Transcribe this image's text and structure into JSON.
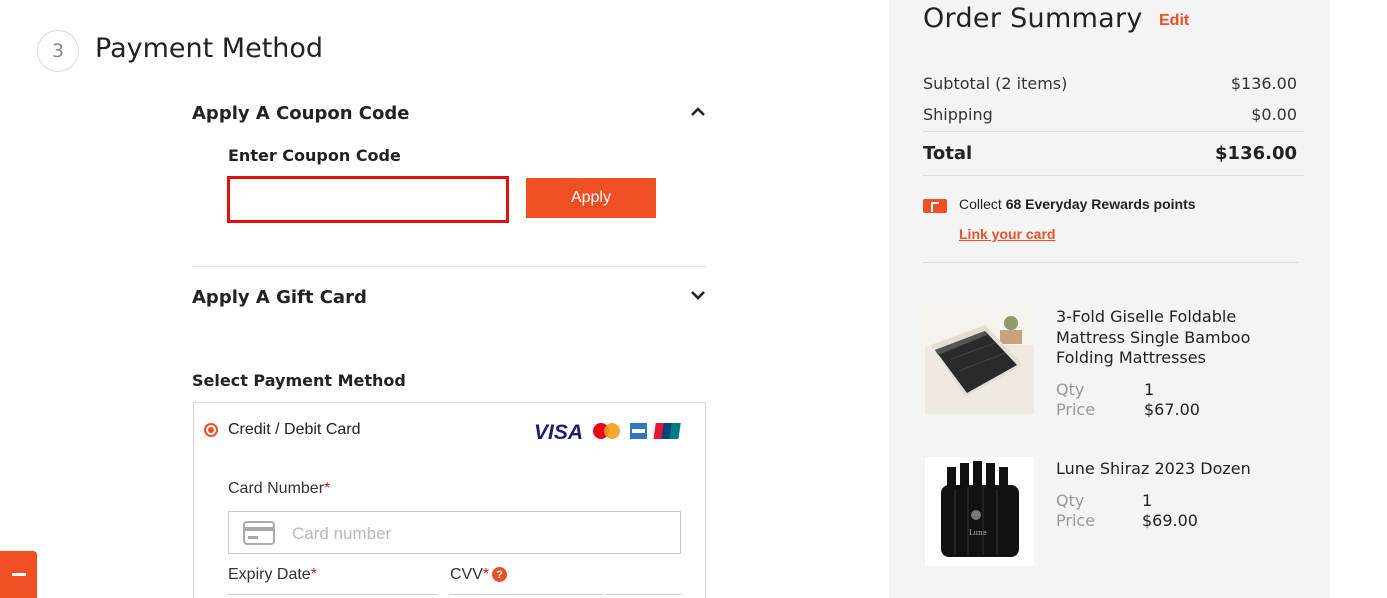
{
  "step": {
    "number": "3",
    "title": "Payment Method"
  },
  "coupon": {
    "heading": "Apply A Coupon Code",
    "field_label": "Enter Coupon Code",
    "value": "",
    "apply_label": "Apply"
  },
  "gift_card": {
    "heading": "Apply A Gift Card"
  },
  "payment": {
    "heading": "Select Payment Method",
    "option_label": "Credit / Debit Card",
    "card_logos": [
      "VISA",
      "mastercard",
      "amex",
      "unionpay"
    ],
    "card_number_label": "Card Number",
    "card_number_placeholder": "Card number",
    "expiry_label": "Expiry Date",
    "cvv_label": "CVV",
    "required_mark": "*",
    "help_glyph": "?"
  },
  "floating_tab": {
    "icon": "minus-icon"
  },
  "summary": {
    "title": "Order Summary",
    "edit_label": "Edit",
    "subtotal_label": "Subtotal (2 items)",
    "subtotal_value": "$136.00",
    "shipping_label": "Shipping",
    "shipping_value": "$0.00",
    "total_label": "Total",
    "total_value": "$136.00",
    "rewards_prefix": "Collect ",
    "rewards_bold": "68 Everyday Rewards points",
    "rewards_link": "Link your card",
    "qty_label": "Qty",
    "price_label": "Price",
    "items": [
      {
        "name": "3-Fold Giselle Foldable Mattress Single Bamboo Folding Mattresses",
        "qty": "1",
        "price": "$67.00"
      },
      {
        "name": "Lune Shiraz 2023 Dozen",
        "qty": "1",
        "price": "$69.00"
      }
    ]
  },
  "colors": {
    "accent": "#f04e23",
    "error_border": "#e01010",
    "panel_bg": "#f4f4f4"
  }
}
